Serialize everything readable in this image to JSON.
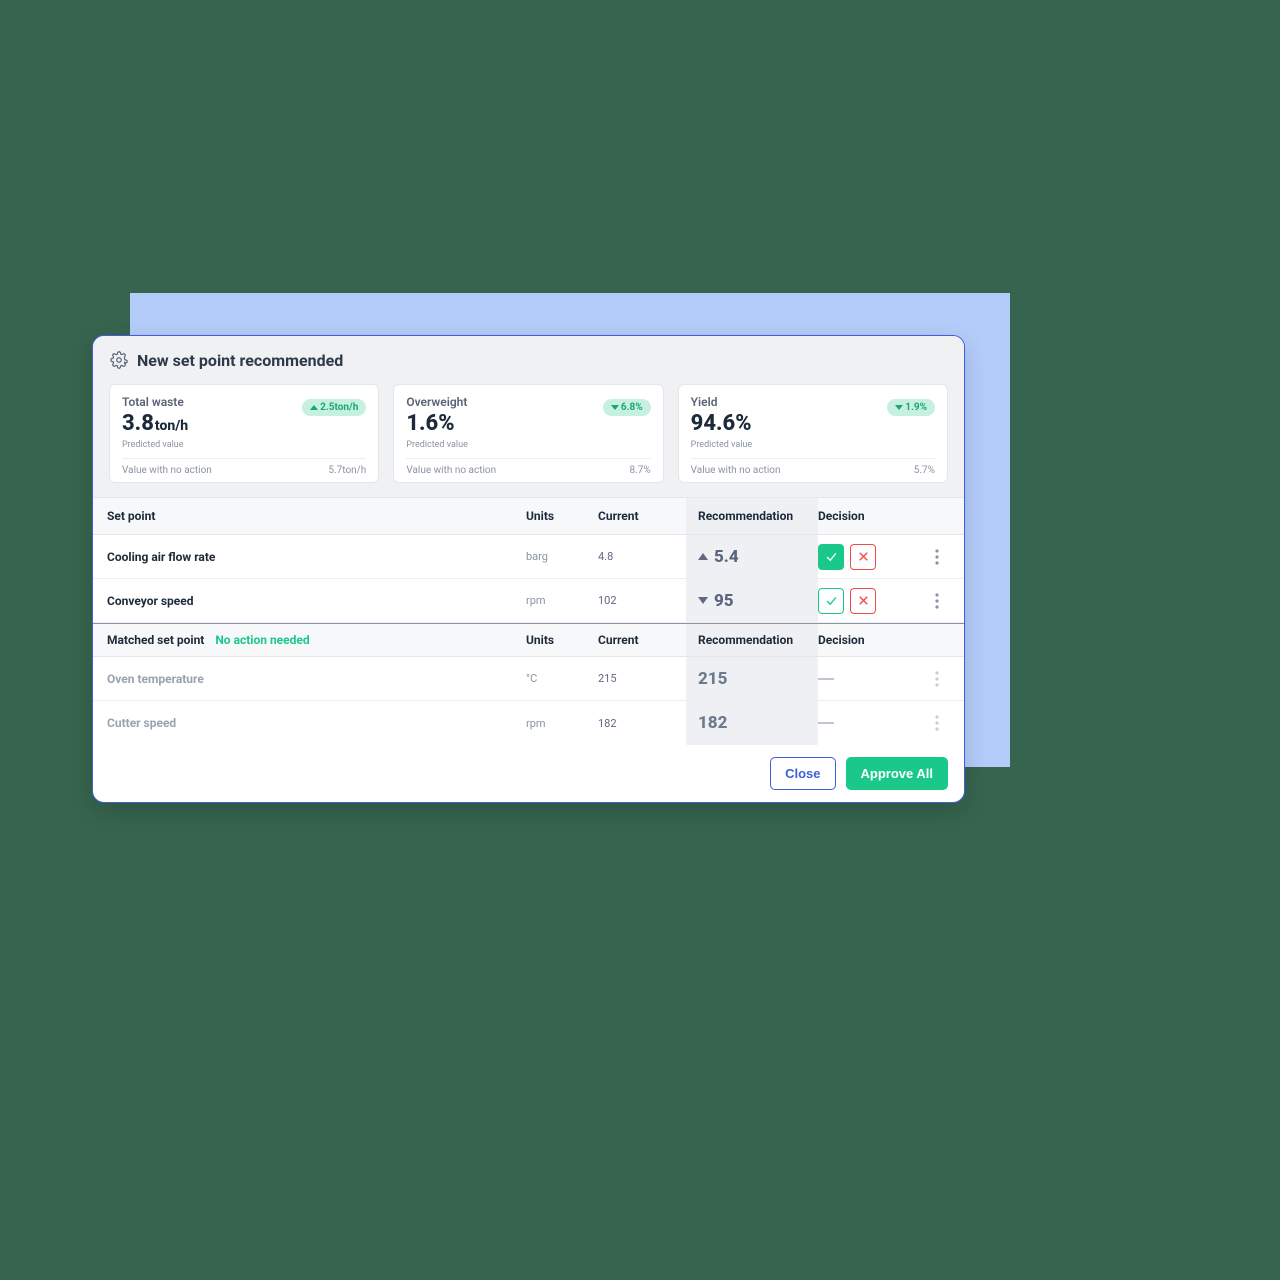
{
  "header": {
    "title": "New set point recommended"
  },
  "kpis": [
    {
      "title": "Total waste",
      "value": "3.8",
      "unit": "ton/h",
      "badge_direction": "up",
      "badge_text": "2.5ton/h",
      "predicted_label": "Predicted value",
      "footer_label": "Value with no action",
      "footer_value": "5.7ton/h"
    },
    {
      "title": "Overweight",
      "value": "1.6%",
      "unit": "",
      "badge_direction": "down",
      "badge_text": "6.8%",
      "predicted_label": "Predicted value",
      "footer_label": "Value with no action",
      "footer_value": "8.7%"
    },
    {
      "title": "Yield",
      "value": "94.6%",
      "unit": "",
      "badge_direction": "down",
      "badge_text": "1.9%",
      "predicted_label": "Predicted value",
      "footer_label": "Value with no action",
      "footer_value": "5.7%"
    }
  ],
  "table": {
    "headers": {
      "setpoint": "Set point",
      "units": "Units",
      "current": "Current",
      "recommendation": "Recommendation",
      "decision": "Decision"
    },
    "rows": [
      {
        "name": "Cooling air flow rate",
        "units": "barg",
        "current": "4.8",
        "rec_direction": "up",
        "rec_value": "5.4",
        "approve_style": "solid"
      },
      {
        "name": "Conveyor speed",
        "units": "rpm",
        "current": "102",
        "rec_direction": "down",
        "rec_value": "95",
        "approve_style": "outline"
      }
    ],
    "matched_header": {
      "label": "Matched set point",
      "note": "No action needed",
      "units": "Units",
      "current": "Current",
      "recommendation": "Recommendation",
      "decision": "Decision"
    },
    "matched_rows": [
      {
        "name": "Oven temperature",
        "units": "°C",
        "current": "215",
        "rec_value": "215"
      },
      {
        "name": "Cutter speed",
        "units": "rpm",
        "current": "182",
        "rec_value": "182"
      }
    ]
  },
  "footer": {
    "close": "Close",
    "approve_all": "Approve All"
  }
}
